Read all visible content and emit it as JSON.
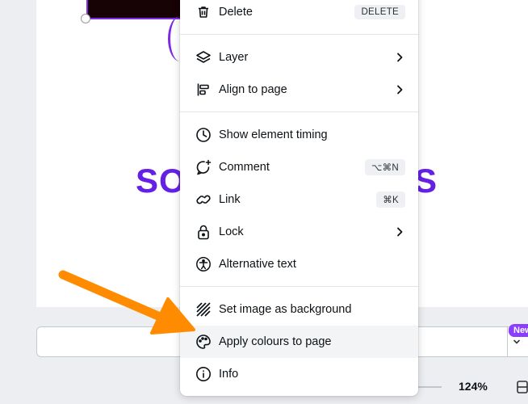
{
  "canvas": {
    "headline_left": "SO",
    "headline_right": "S"
  },
  "menu": {
    "items": [
      {
        "label": "Delete",
        "shortcut": "DELETE"
      },
      {
        "label": "Layer",
        "submenu": true
      },
      {
        "label": "Align to page",
        "submenu": true
      },
      {
        "label": "Show element timing"
      },
      {
        "label": "Comment",
        "shortcut": "⌥⌘N"
      },
      {
        "label": "Link",
        "shortcut": "⌘K"
      },
      {
        "label": "Lock",
        "submenu": true
      },
      {
        "label": "Alternative text"
      },
      {
        "label": "Set image as background"
      },
      {
        "label": "Apply colours to page",
        "highlighted": true
      },
      {
        "label": "Info"
      }
    ]
  },
  "bottom_bar": {
    "new_badge": "New",
    "zoom": "124%"
  },
  "colors": {
    "accent_purple": "#7d2ae8",
    "headline_purple": "#6520e6",
    "annotation_arrow": "#ff8c00"
  }
}
